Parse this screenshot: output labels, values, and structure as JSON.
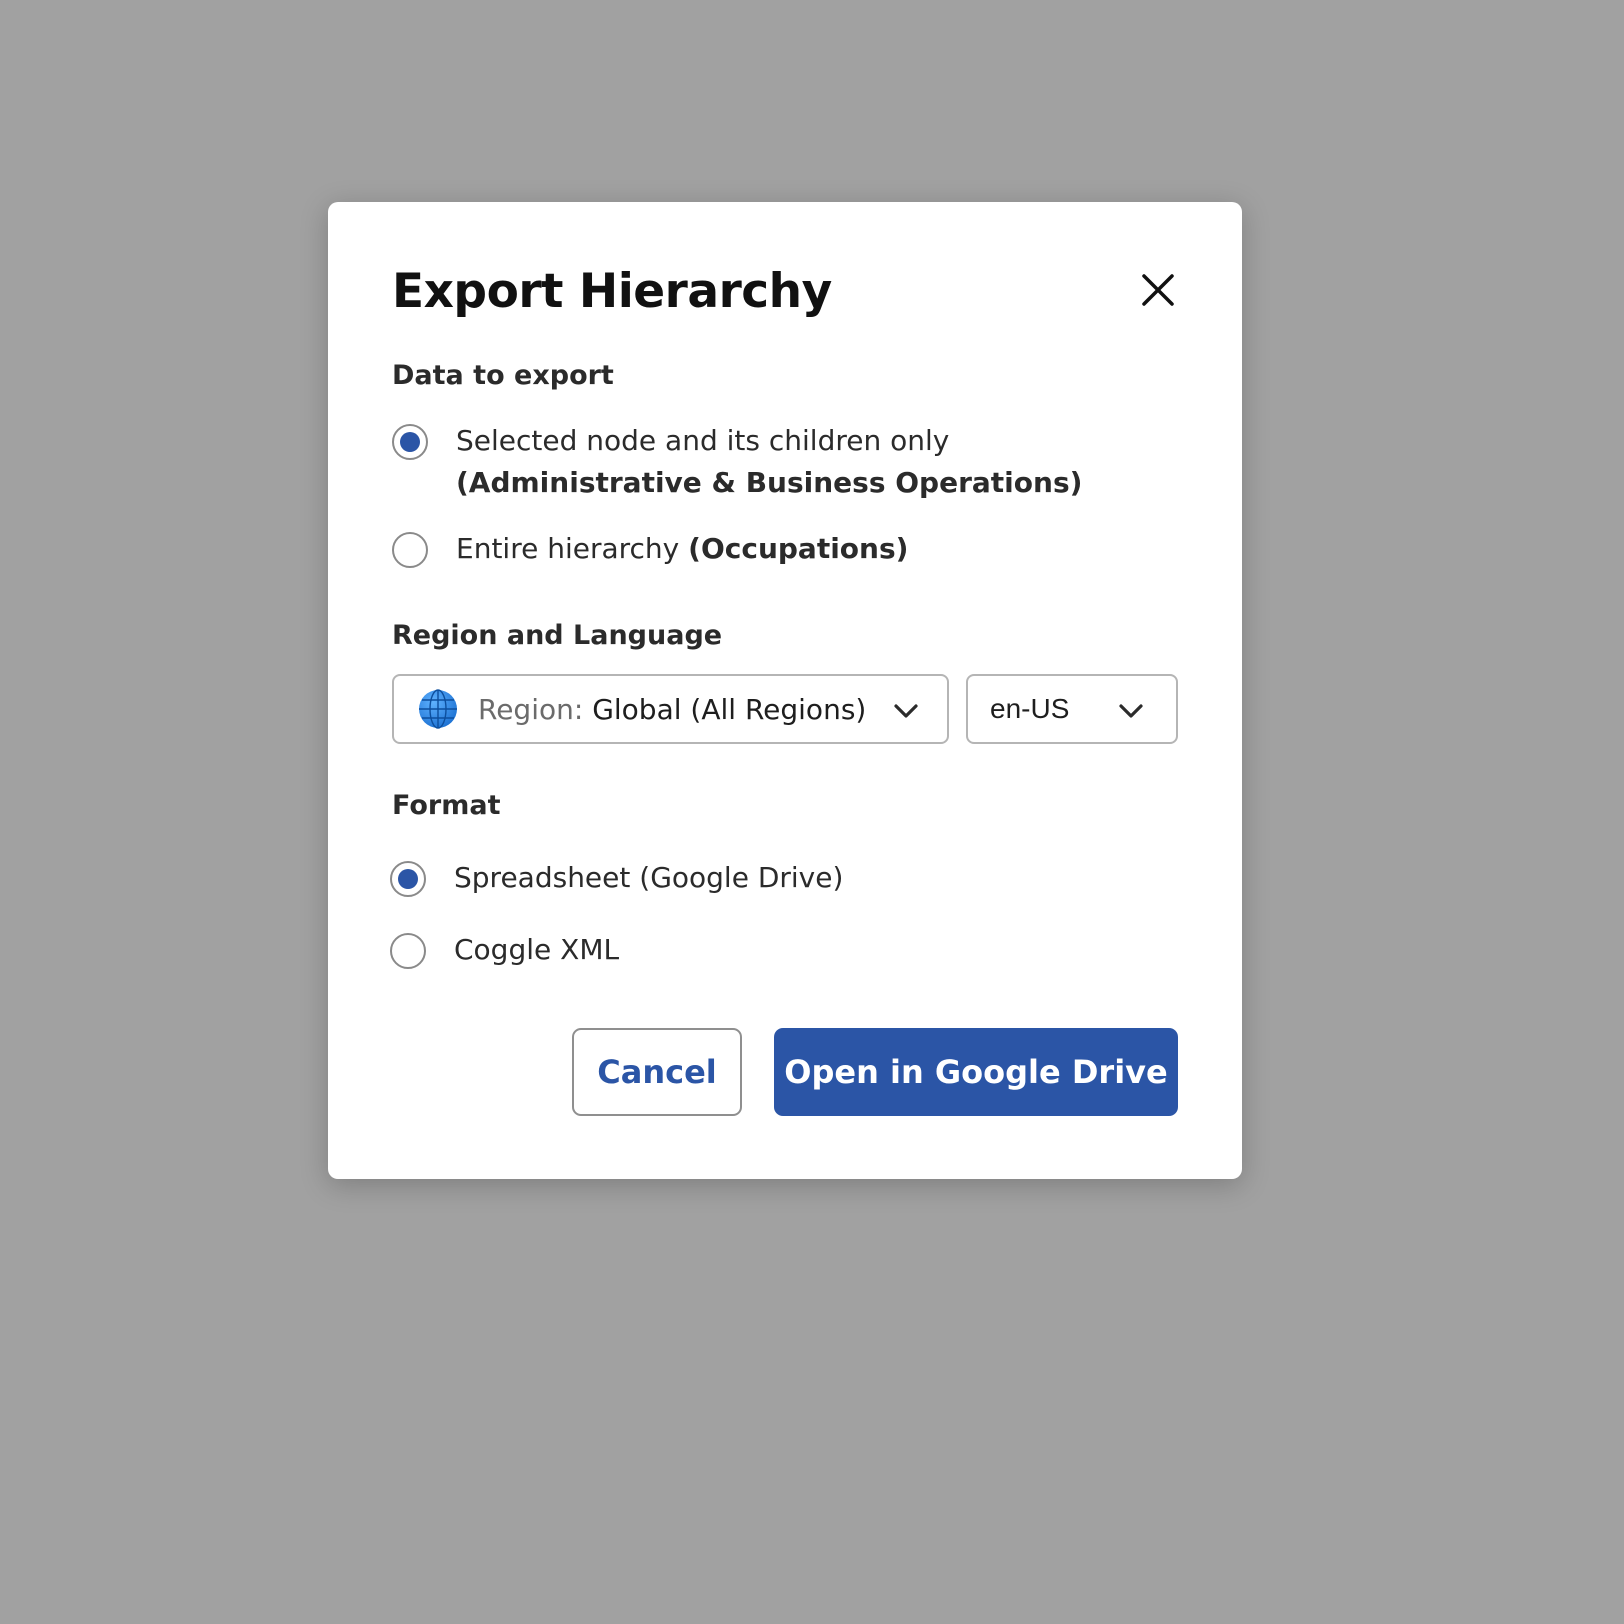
{
  "dialog": {
    "title": "Export Hierarchy",
    "close_icon": "close-icon"
  },
  "data_to_export": {
    "label": "Data to export",
    "options": [
      {
        "label": "Selected node and its children only",
        "detail": "(Administrative & Business Operations)",
        "selected": true
      },
      {
        "label": "Entire hierarchy",
        "detail": "(Occupations)",
        "selected": false
      }
    ]
  },
  "region_language": {
    "label": "Region and Language",
    "region_icon": "globe-icon",
    "region_prefix": "Region:",
    "region_value": "Global (All Regions)",
    "language_value": "en-US"
  },
  "format": {
    "label": "Format",
    "options": [
      {
        "label": "Spreadsheet (Google Drive)",
        "selected": true
      },
      {
        "label": "Coggle XML",
        "selected": false
      }
    ]
  },
  "actions": {
    "cancel_label": "Cancel",
    "primary_label": "Open in Google Drive"
  },
  "colors": {
    "overlay": "#a1a1a1",
    "accent": "#2b55a6",
    "text": "#2b2b2b"
  }
}
